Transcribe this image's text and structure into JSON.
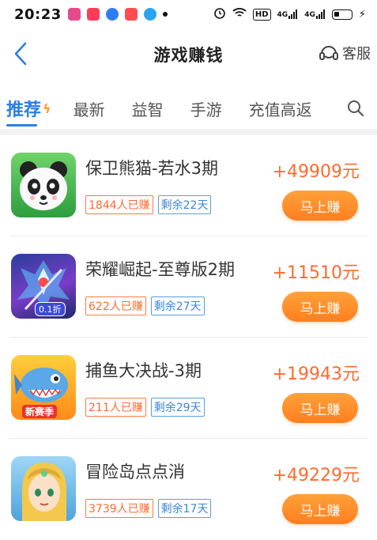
{
  "status_bar": {
    "time": "20:23",
    "hd_badge": "HD",
    "network_1": "4G",
    "network_2": "4G"
  },
  "header": {
    "title": "游戏赚钱",
    "service_label": "客服"
  },
  "tabs": [
    {
      "label": "推荐",
      "active": true
    },
    {
      "label": "最新",
      "active": false
    },
    {
      "label": "益智",
      "active": false
    },
    {
      "label": "手游",
      "active": false
    },
    {
      "label": "充值高返",
      "active": false
    }
  ],
  "games": [
    {
      "name": "保卫熊猫-若水3期",
      "earned": "1844人已赚",
      "remaining": "剩余22天",
      "reward": "+49909元",
      "button": "马上赚",
      "icon": "panda-game-icon"
    },
    {
      "name": "荣耀崛起-至尊版2期",
      "earned": "622人已赚",
      "remaining": "剩余27天",
      "reward": "+11510元",
      "button": "马上赚",
      "icon": "glory-rise-game-icon",
      "icon_tag": "0.1折"
    },
    {
      "name": "捕鱼大决战-3期",
      "earned": "211人已赚",
      "remaining": "剩余29天",
      "reward": "+19943元",
      "button": "马上赚",
      "icon": "fishing-game-icon",
      "icon_tag": "新赛季"
    },
    {
      "name": "冒险岛点点消",
      "earned": "3739人已赚",
      "remaining": "剩余17天",
      "reward": "+49229元",
      "button": "马上赚",
      "icon": "adventure-island-game-icon"
    }
  ],
  "colors": {
    "accent_blue": "#2b7fe0",
    "reward_orange": "#ff6a30",
    "button_orange": "#ff8a24"
  }
}
